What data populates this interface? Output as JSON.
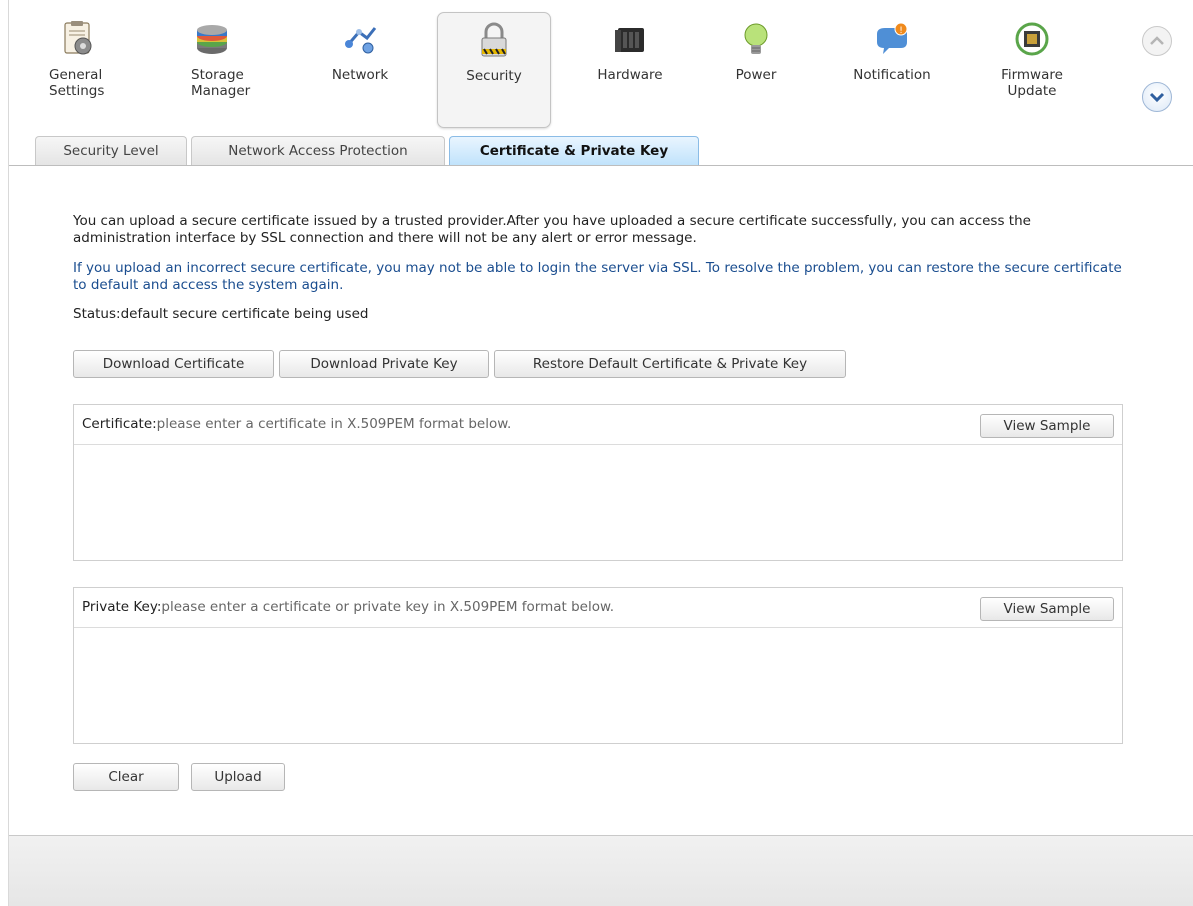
{
  "toolbar": {
    "items": [
      {
        "label": "General Settings",
        "icon": "general-settings-icon"
      },
      {
        "label": "Storage Manager",
        "icon": "storage-manager-icon"
      },
      {
        "label": "Network",
        "icon": "network-icon"
      },
      {
        "label": "Security",
        "icon": "security-icon"
      },
      {
        "label": "Hardware",
        "icon": "hardware-icon"
      },
      {
        "label": "Power",
        "icon": "power-icon"
      },
      {
        "label": "Notification",
        "icon": "notification-icon"
      },
      {
        "label": "Firmware Update",
        "icon": "firmware-update-icon"
      }
    ],
    "active": "Security"
  },
  "tabs": [
    {
      "label": "Security Level"
    },
    {
      "label": "Network Access Protection"
    },
    {
      "label": "Certificate & Private Key"
    }
  ],
  "content": {
    "intro": "You can upload a secure certificate issued by a trusted provider.After you have uploaded a secure certificate successfully, you can access the administration interface by SSL connection and there will not be any alert or error message.",
    "warning": "If you upload an incorrect secure certificate, you may not be able to login the server via SSL. To resolve the problem, you can restore the secure certificate to default and access the system again.",
    "status": "Status:default secure certificate being used",
    "buttons": {
      "download_certificate": "Download Certificate",
      "download_private_key": "Download Private Key",
      "restore_default": "Restore Default Certificate & Private Key",
      "clear": "Clear",
      "upload": "Upload"
    },
    "certificate": {
      "label": "Certificate:",
      "hint": "please enter a certificate in X.509PEM format below.",
      "view_sample": "View Sample",
      "value": ""
    },
    "private_key": {
      "label": "Private Key:",
      "hint": "please enter a certificate or private key in X.509PEM format below.",
      "view_sample": "View Sample",
      "value": ""
    }
  }
}
